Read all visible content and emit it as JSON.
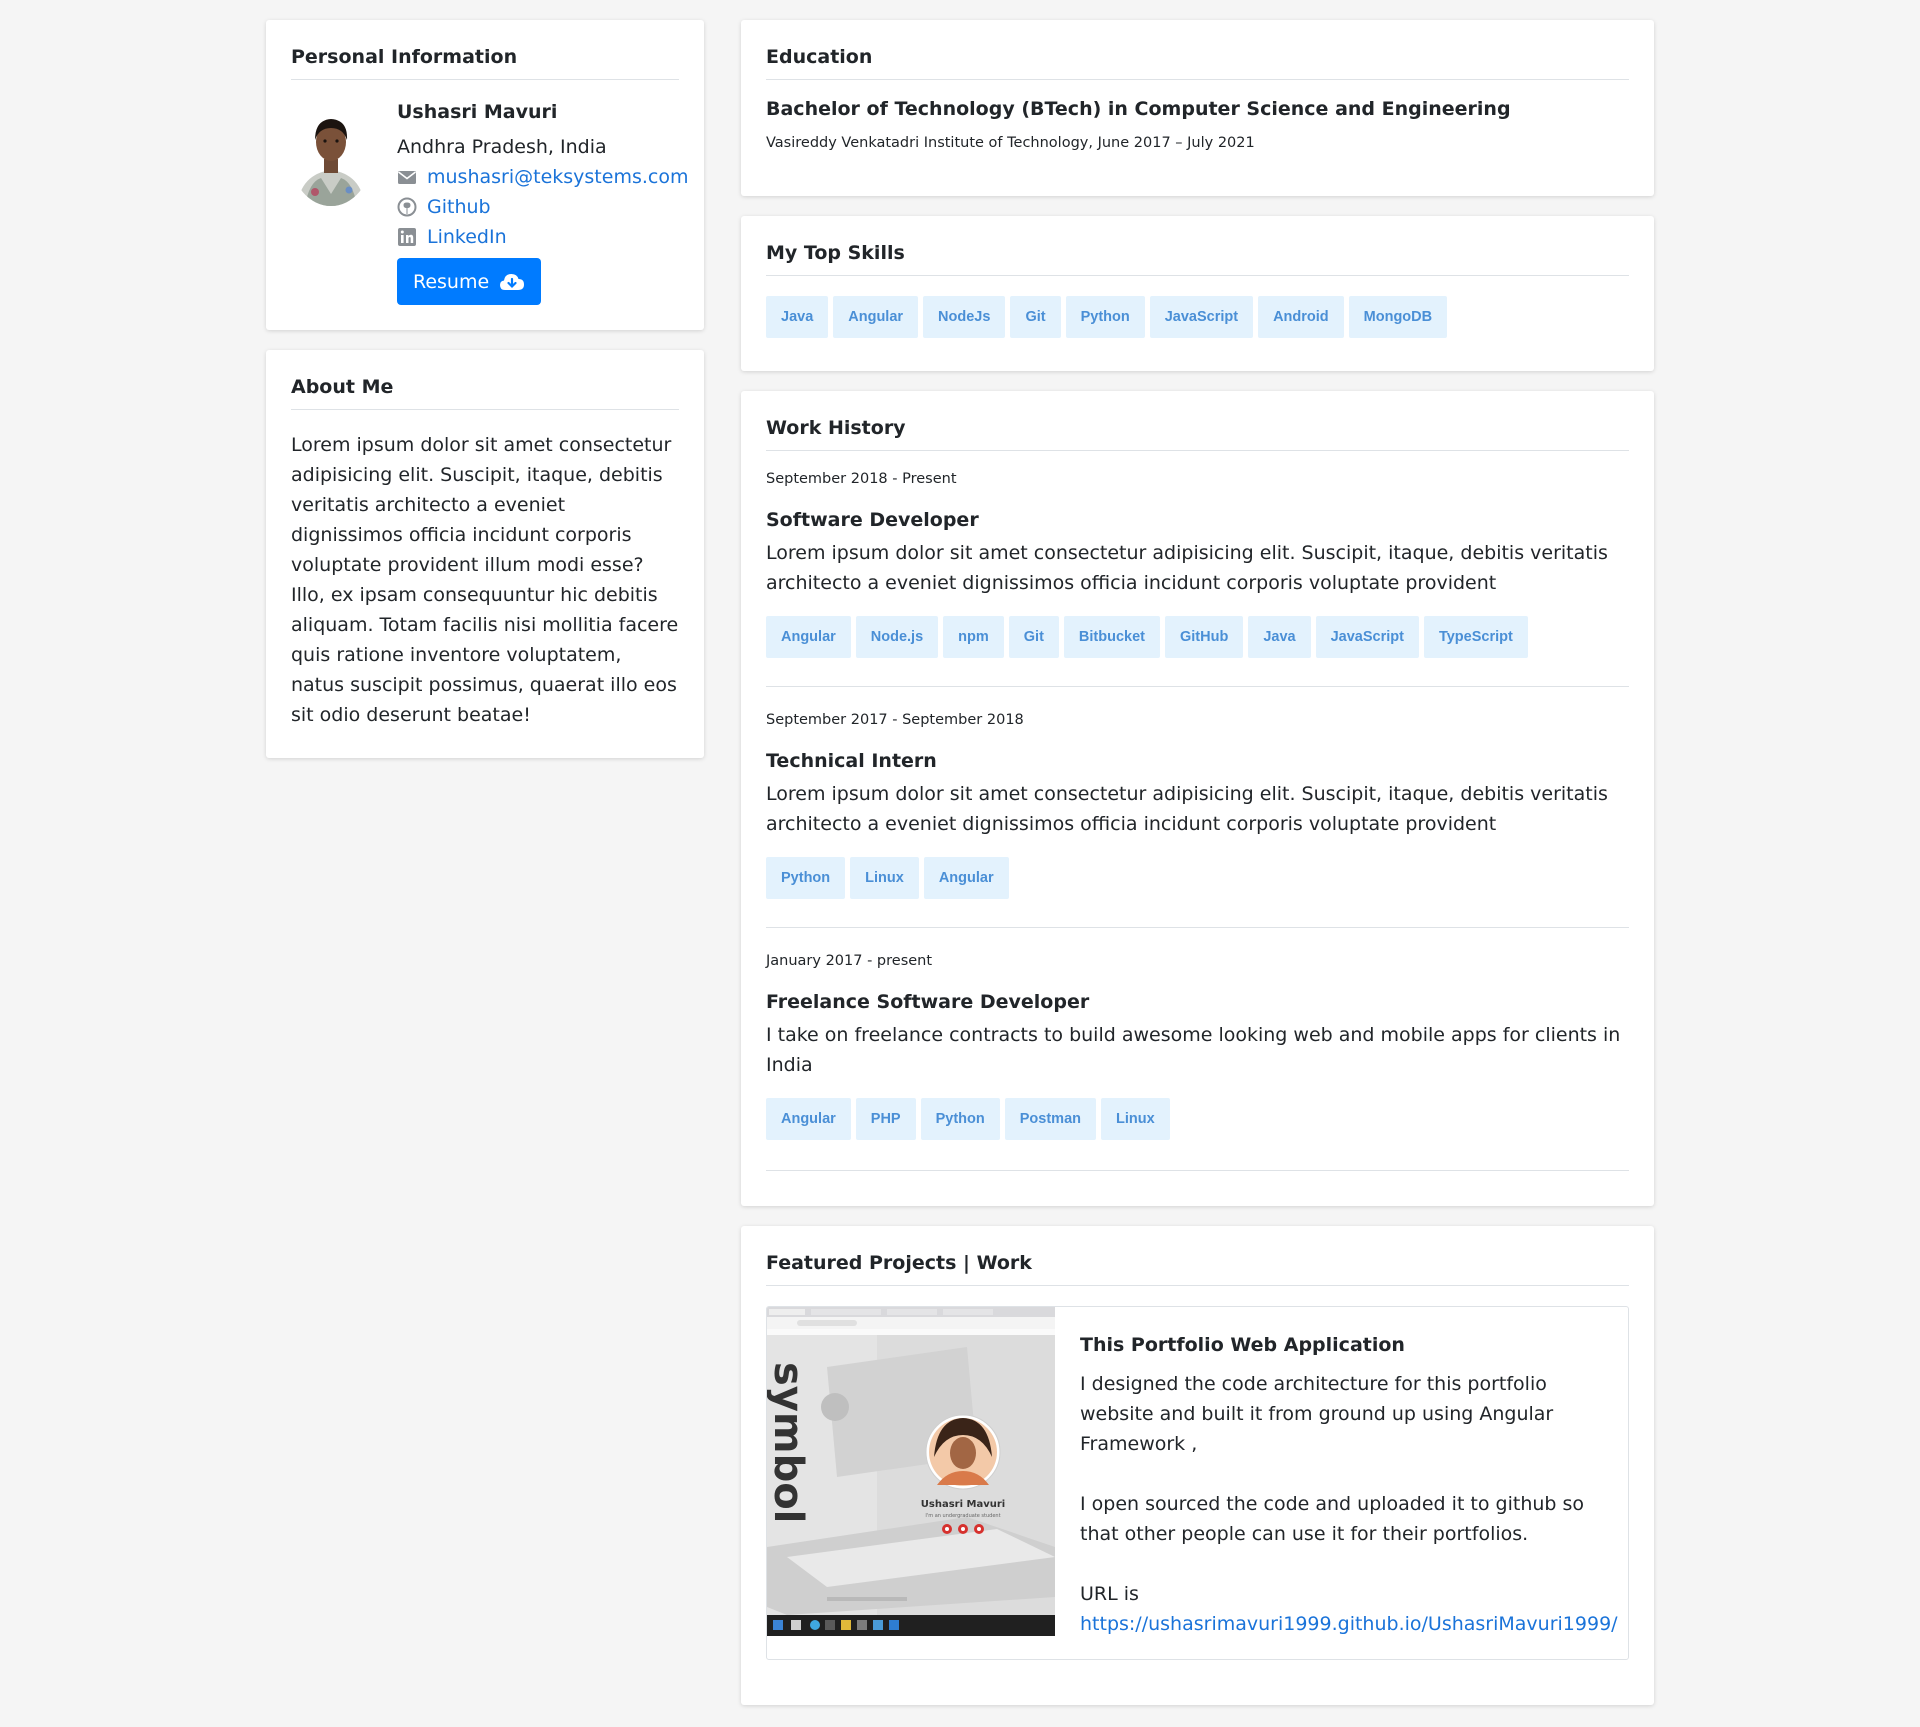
{
  "personal": {
    "title": "Personal Information",
    "name": "Ushasri Mavuri",
    "location": "Andhra Pradesh, India",
    "email": "mushasri@teksystems.com",
    "github": "Github",
    "linkedin": "LinkedIn",
    "resume_label": "Resume"
  },
  "about": {
    "title": "About Me",
    "text": "Lorem ipsum dolor sit amet consectetur adipisicing elit. Suscipit, itaque, debitis veritatis architecto a eveniet dignissimos officia incidunt corporis voluptate provident illum modi esse? Illo, ex ipsam consequuntur hic debitis aliquam. Totam facilis nisi mollitia facere quis ratione inventore voluptatem, natus suscipit possimus, quaerat illo eos sit odio deserunt beatae!"
  },
  "education": {
    "title": "Education",
    "degree": "Bachelor of Technology (BTech) in Computer Science and Engineering",
    "school": "Vasireddy Venkatadri Institute of Technology, June 2017 – July 2021"
  },
  "skills": {
    "title": "My Top Skills",
    "items": [
      "Java",
      "Angular",
      "NodeJs",
      "Git",
      "Python",
      "JavaScript",
      "Android",
      "MongoDB"
    ]
  },
  "work": {
    "title": "Work History",
    "jobs": [
      {
        "date": "September 2018 - Present",
        "title": "Software Developer",
        "desc": "Lorem ipsum dolor sit amet consectetur adipisicing elit. Suscipit, itaque, debitis veritatis architecto a eveniet dignissimos officia incidunt corporis voluptate provident",
        "tags": [
          "Angular",
          "Node.js",
          "npm",
          "Git",
          "Bitbucket",
          "GitHub",
          "Java",
          "JavaScript",
          "TypeScript"
        ]
      },
      {
        "date": "September 2017 - September 2018",
        "title": "Technical Intern",
        "desc": "Lorem ipsum dolor sit amet consectetur adipisicing elit. Suscipit, itaque, debitis veritatis architecto a eveniet dignissimos officia incidunt corporis voluptate provident",
        "tags": [
          "Python",
          "Linux",
          "Angular"
        ]
      },
      {
        "date": "January 2017 - present",
        "title": "Freelance Software Developer",
        "desc": "I take on freelance contracts to build awesome looking web and mobile apps for clients in India",
        "tags": [
          "Angular",
          "PHP",
          "Python",
          "Postman",
          "Linux"
        ]
      }
    ]
  },
  "projects": {
    "title": "Featured Projects | Work",
    "item": {
      "title": "This Portfolio Web Application",
      "p1": "I designed the code architecture for this portfolio website and built it from ground up using Angular Framework ,",
      "p2": "I open sourced the code and uploaded it to github so that other people can use it for their portfolios.",
      "url_label": "URL is",
      "url": "https://ushasrimavuri1999.github.io/UshasriMavuri1999/",
      "thumb_name": "Ushasri Mavuri",
      "thumb_sub": "I'm an undergraduate student",
      "thumb_word": "symbol"
    }
  },
  "colors": {
    "accent": "#007bff",
    "link": "#1a73d9",
    "chip_bg": "#e3f2fd",
    "chip_text": "#4a8fd6"
  }
}
